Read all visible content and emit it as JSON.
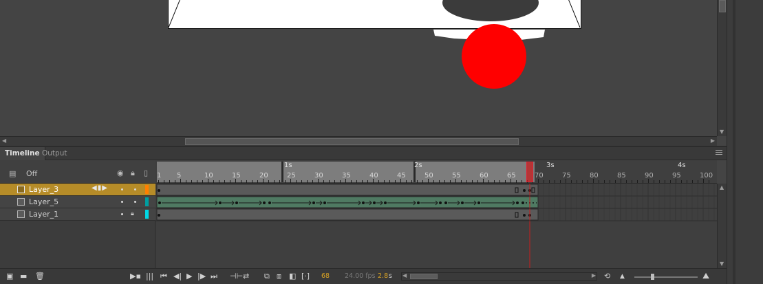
{
  "panel": {
    "tabs": [
      {
        "label": "Timeline",
        "active": true
      },
      {
        "label": "Output",
        "active": false
      }
    ]
  },
  "layer_header": {
    "off_label": "Off",
    "icons": [
      "camera-layer-icon",
      "eye-icon",
      "lock-icon",
      "outline-icon"
    ]
  },
  "ruler": {
    "seconds": [
      "1s",
      "2s",
      "3s",
      "4s"
    ],
    "frame_numbers": [
      1,
      5,
      10,
      15,
      20,
      25,
      30,
      35,
      40,
      45,
      50,
      55,
      60,
      65,
      70,
      75,
      80,
      85,
      90,
      95,
      100
    ],
    "playhead_frame": 68,
    "last_frame": 69
  },
  "layers": [
    {
      "name": "Layer_3",
      "selected": true,
      "locked": false,
      "color": "#ff7f00"
    },
    {
      "name": "Layer_5",
      "selected": false,
      "locked": false,
      "color": "#009ea0"
    },
    {
      "name": "Layer_1",
      "selected": false,
      "locked": true,
      "color": "#00d8e6"
    }
  ],
  "bottom_bar": {
    "current_frame": "68",
    "fps": "24.00 fps",
    "elapsed": "2.8",
    "elapsed_unit": "s"
  },
  "colors": {
    "selection": "#b68c28",
    "tween": "#4f7a62",
    "playhead": "#c81e1e",
    "stage_red": "#ff0000"
  }
}
